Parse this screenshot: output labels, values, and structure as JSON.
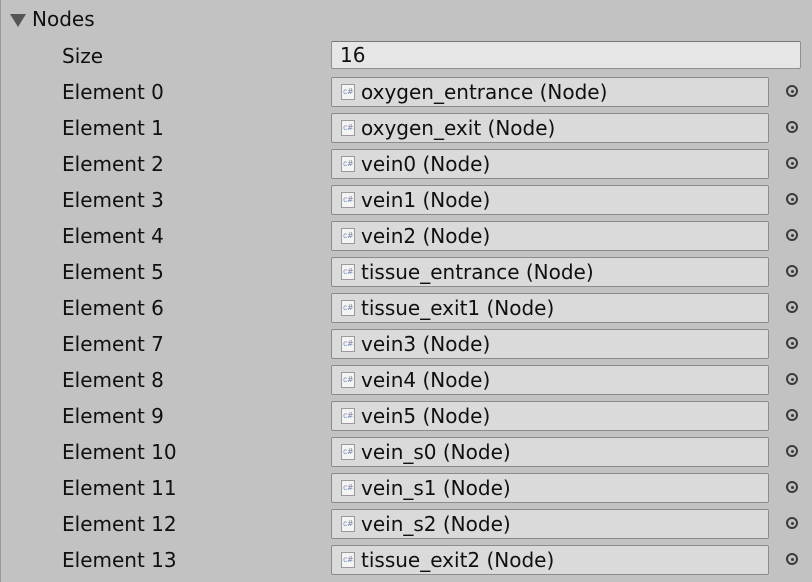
{
  "inspector": {
    "foldout_label": "Nodes",
    "size_label": "Size",
    "size_value": "16",
    "icon_text": "c#",
    "elements": [
      {
        "label": "Element 0",
        "value": "oxygen_entrance (Node)"
      },
      {
        "label": "Element 1",
        "value": "oxygen_exit (Node)"
      },
      {
        "label": "Element 2",
        "value": "vein0 (Node)"
      },
      {
        "label": "Element 3",
        "value": "vein1 (Node)"
      },
      {
        "label": "Element 4",
        "value": "vein2 (Node)"
      },
      {
        "label": "Element 5",
        "value": "tissue_entrance (Node)"
      },
      {
        "label": "Element 6",
        "value": "tissue_exit1 (Node)"
      },
      {
        "label": "Element 7",
        "value": "vein3 (Node)"
      },
      {
        "label": "Element 8",
        "value": "vein4 (Node)"
      },
      {
        "label": "Element 9",
        "value": "vein5 (Node)"
      },
      {
        "label": "Element 10",
        "value": "vein_s0 (Node)"
      },
      {
        "label": "Element 11",
        "value": "vein_s1 (Node)"
      },
      {
        "label": "Element 12",
        "value": "vein_s2 (Node)"
      },
      {
        "label": "Element 13",
        "value": "tissue_exit2 (Node)"
      }
    ]
  }
}
